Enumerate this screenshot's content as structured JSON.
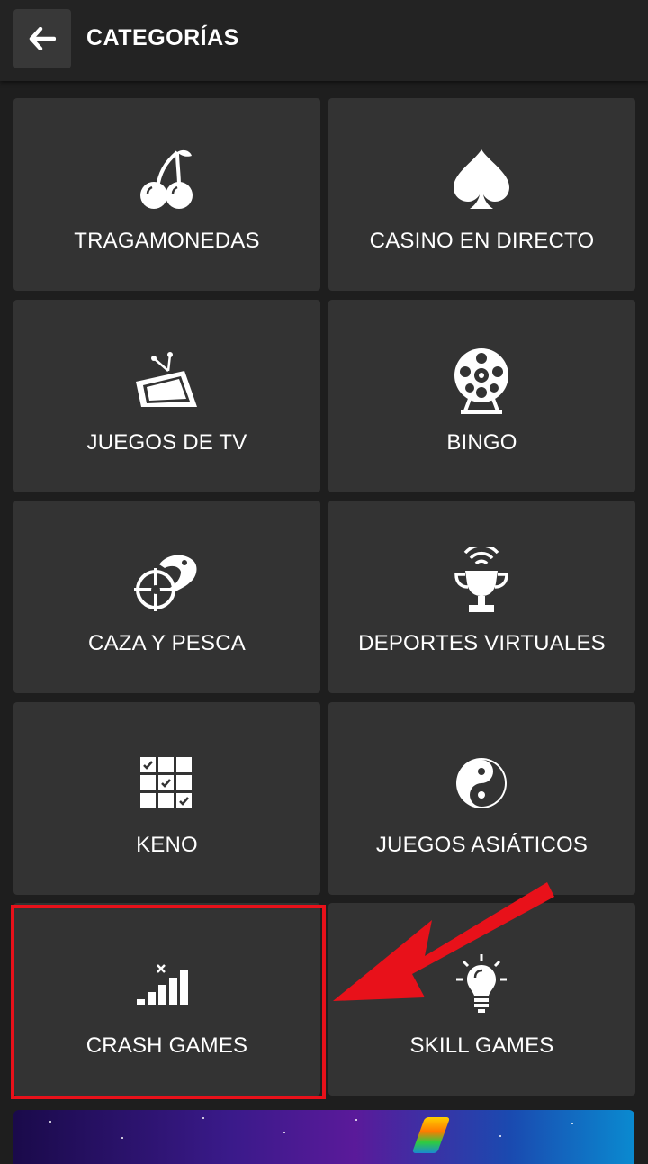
{
  "header": {
    "back_icon": "arrow-left-icon",
    "title": "CATEGORÍAS"
  },
  "categories": [
    {
      "label": "TRAGAMONEDAS",
      "icon": "cherries-icon"
    },
    {
      "label": "CASINO EN DIRECTO",
      "icon": "spade-icon"
    },
    {
      "label": "JUEGOS DE TV",
      "icon": "tv-icon"
    },
    {
      "label": "BINGO",
      "icon": "bingo-drum-icon"
    },
    {
      "label": "CAZA Y PESCA",
      "icon": "crosshair-fish-icon"
    },
    {
      "label": "DEPORTES VIRTUALES",
      "icon": "trophy-signal-icon"
    },
    {
      "label": "KENO",
      "icon": "keno-grid-icon"
    },
    {
      "label": "JUEGOS ASIÁTICOS",
      "icon": "yin-yang-icon"
    },
    {
      "label": "CRASH GAMES",
      "icon": "crash-bars-icon"
    },
    {
      "label": "SKILL GAMES",
      "icon": "lightbulb-icon"
    }
  ],
  "annotation": {
    "highlight_color": "#e8111a",
    "arrow_color": "#e8111a",
    "highlighted_category": "CRASH GAMES"
  }
}
